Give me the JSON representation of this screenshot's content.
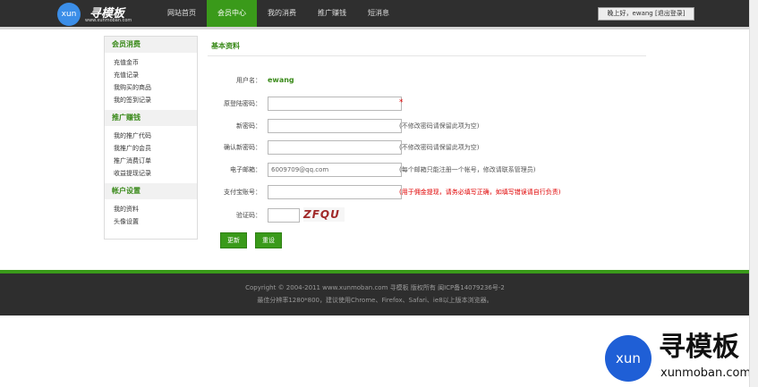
{
  "logo": {
    "badge": "xun",
    "title": "寻模板",
    "url": "www.xunmoban.com"
  },
  "nav": {
    "items": [
      {
        "label": "网站首页"
      },
      {
        "label": "会员中心"
      },
      {
        "label": "我的消费"
      },
      {
        "label": "推广赚钱"
      },
      {
        "label": "短消息"
      }
    ],
    "active_index": 1
  },
  "user": {
    "greeting": "晚上好，ewang [退出登录]"
  },
  "sidebar": {
    "sections": [
      {
        "title": "会员消费",
        "links": [
          "充值金币",
          "充值记录",
          "我购买的商品",
          "我的签到记录"
        ]
      },
      {
        "title": "推广赚钱",
        "links": [
          "我的推广代码",
          "我推广的会员",
          "推广消费订单",
          "收益提现记录"
        ]
      },
      {
        "title": "帐户设置",
        "links": [
          "我的资料",
          "头像设置"
        ]
      }
    ]
  },
  "main": {
    "title": "基本资料",
    "username_label": "用户名：",
    "username_value": "ewang",
    "orig_pwd_label": "原登陆密码：",
    "required_mark": "*",
    "new_pwd_label": "新密码：",
    "new_pwd_hint": "(不修改密码请保留此项为空)",
    "confirm_pwd_label": "确认新密码：",
    "confirm_pwd_hint": "(不修改密码请保留此项为空)",
    "email_label": "电子邮箱：",
    "email_value": "6009709@qq.com",
    "email_hint": "(每个邮箱只能注册一个帐号，修改请联系管理员)",
    "alipay_label": "支付宝账号：",
    "alipay_hint": "(用于佣金提现，请务必填写正确，如填写错误请自行负责)",
    "captcha_label": "验证码：",
    "captcha_text": "ZFQU",
    "submit_label": "更新",
    "reset_label": "重设"
  },
  "footer": {
    "line1": "Copyright © 2004-2011 www.xunmoban.com   寻模板   版权所有  闽ICP备14079236号-2",
    "line2": "最佳分辨率1280*800，建议使用Chrome、Firefox、Safari、ie8以上版本浏览器。"
  },
  "watermark": {
    "badge": "xun",
    "title": "寻模板",
    "url": "xunmoban.com"
  },
  "colors": {
    "accent_green": "#3a9a1a",
    "header_dark": "#2f2f2f",
    "error_red": "#e00000",
    "logo_blue": "#3b8ee8"
  }
}
